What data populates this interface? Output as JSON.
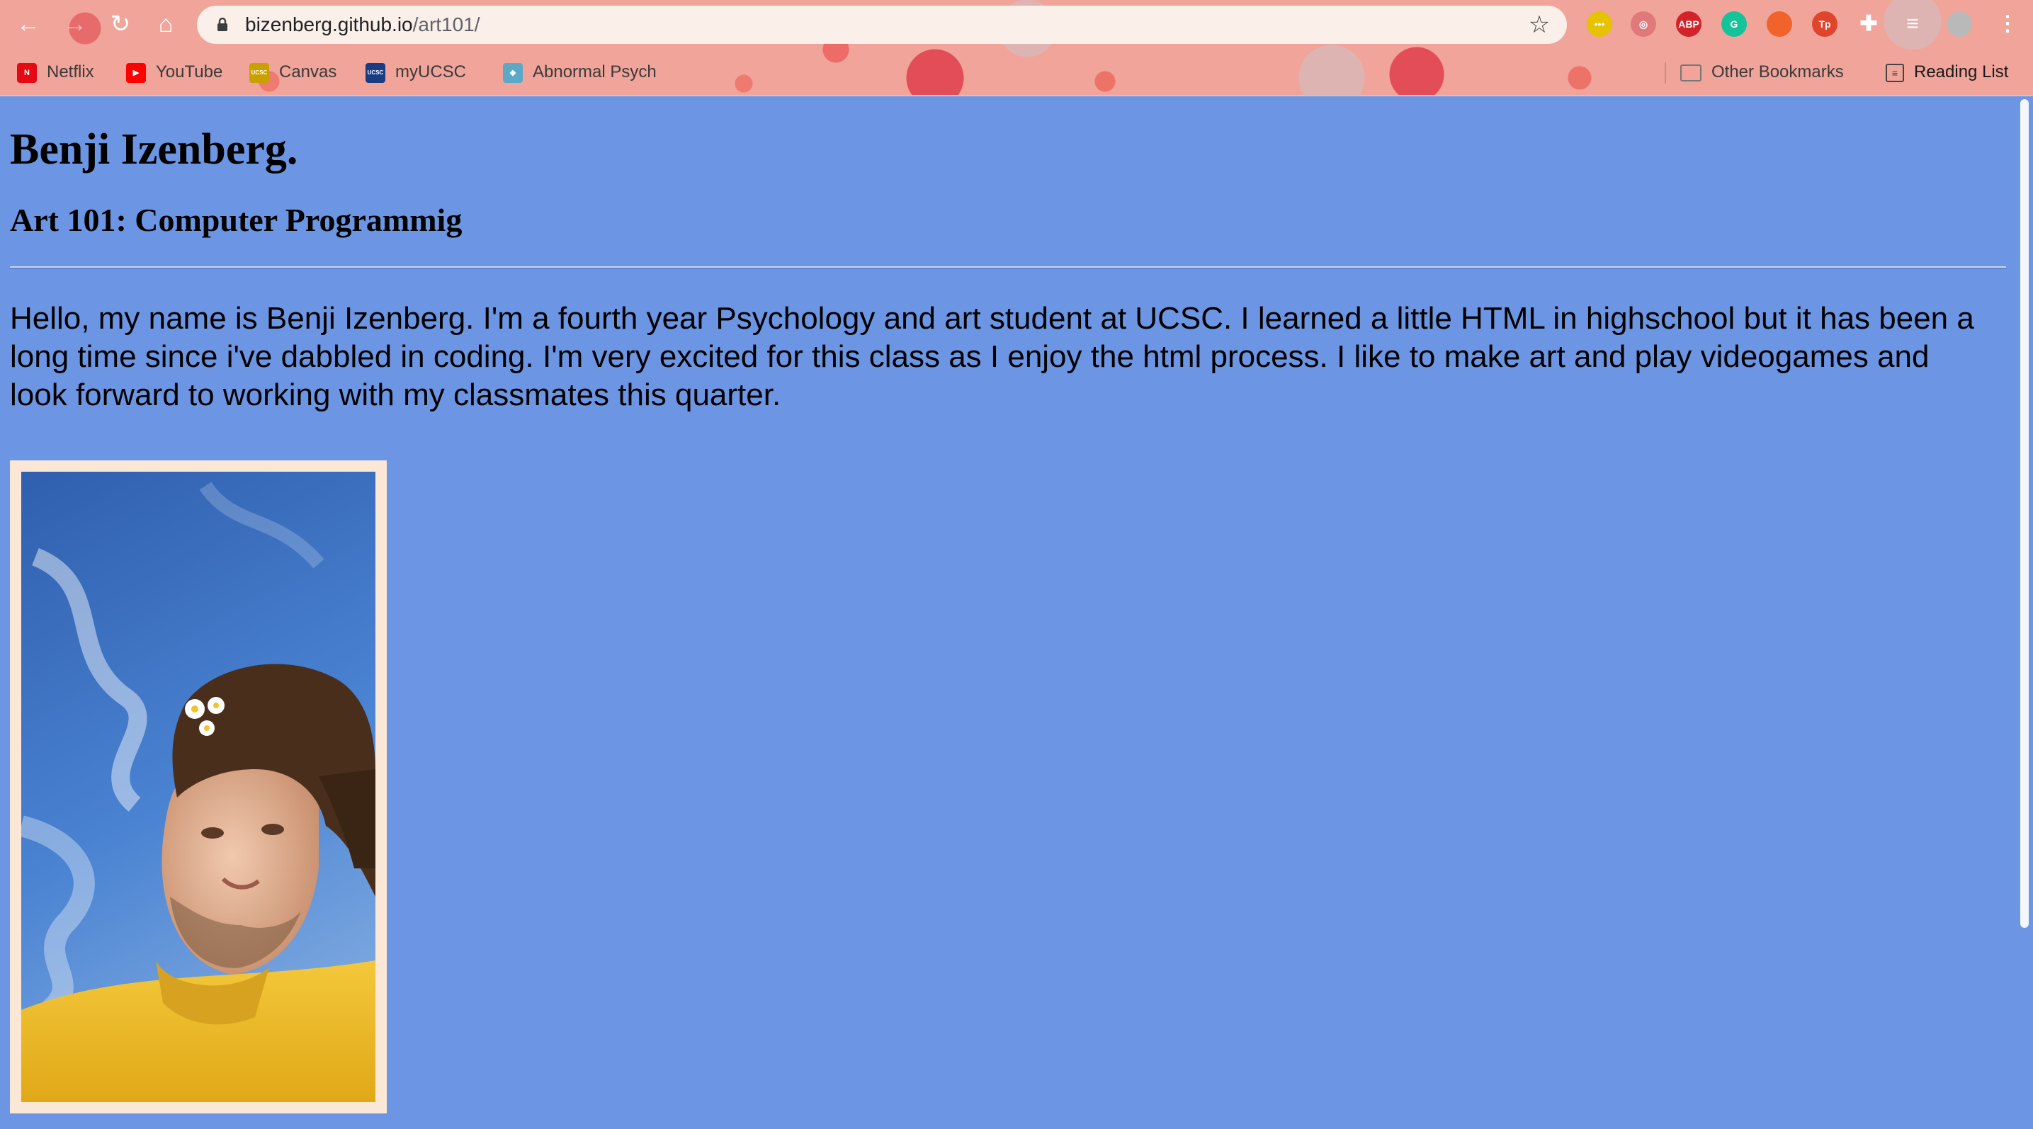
{
  "browser": {
    "url_host": "bizenberg.github.io",
    "url_path": "/art101/",
    "nav": {
      "back_icon": "back-arrow-icon",
      "forward_icon": "forward-arrow-icon",
      "reload_icon": "reload-icon",
      "home_icon": "home-icon"
    },
    "extensions": [
      {
        "name": "ext-yellow-icon",
        "text": "•••",
        "color": "#e6c200"
      },
      {
        "name": "ext-dribbble-icon",
        "text": "◎",
        "color": "#e07a7a"
      },
      {
        "name": "adblock-plus-icon",
        "text": "ABP",
        "color": "#d2232a"
      },
      {
        "name": "grammarly-icon",
        "text": "G",
        "color": "#15c39a"
      },
      {
        "name": "ext-orange-icon",
        "text": "",
        "color": "#f0642c"
      },
      {
        "name": "ext-tp-icon",
        "text": "Tp",
        "color": "#e0442c"
      },
      {
        "name": "extensions-puzzle-icon",
        "text": "✚",
        "color": "#ffffff"
      },
      {
        "name": "media-queue-icon",
        "text": "≡",
        "color": "#ffffff"
      },
      {
        "name": "profile-avatar-icon",
        "text": "",
        "color": "#b9b9b9"
      },
      {
        "name": "kebab-menu-icon",
        "text": "⋮",
        "color": "#ffffff"
      }
    ],
    "bookmarks": [
      {
        "label": "Netflix",
        "fav": "N",
        "color": "#e50914"
      },
      {
        "label": "YouTube",
        "fav": "▶",
        "color": "#ff0000"
      },
      {
        "label": "Canvas",
        "fav": "UCSC",
        "color": "#c8a100"
      },
      {
        "label": "myUCSC",
        "fav": "UCSC",
        "color": "#1a3c84"
      },
      {
        "label": "Abnormal Psych",
        "fav": "◆",
        "color": "#5aa9c9"
      }
    ],
    "other_bookmarks": "Other Bookmarks",
    "reading_list": "Reading List"
  },
  "page": {
    "title": "Benji Izenberg.",
    "subtitle": "Art 101: Computer Programmig",
    "intro": "Hello, my name is Benji Izenberg. I'm a fourth year Psychology and art student at UCSC. I learned a little HTML in highschool but it has been a long time since i've dabbled in coding. I'm very excited for this class as I enjoy the html process. I like to make art and play videogames and look forward to working with my classmates this quarter.",
    "photo": {
      "sky_color": "#3f74c8",
      "shirt_color": "#f2c230",
      "frame_color": "#fbe7d6"
    },
    "background_color": "#6c95e4"
  }
}
